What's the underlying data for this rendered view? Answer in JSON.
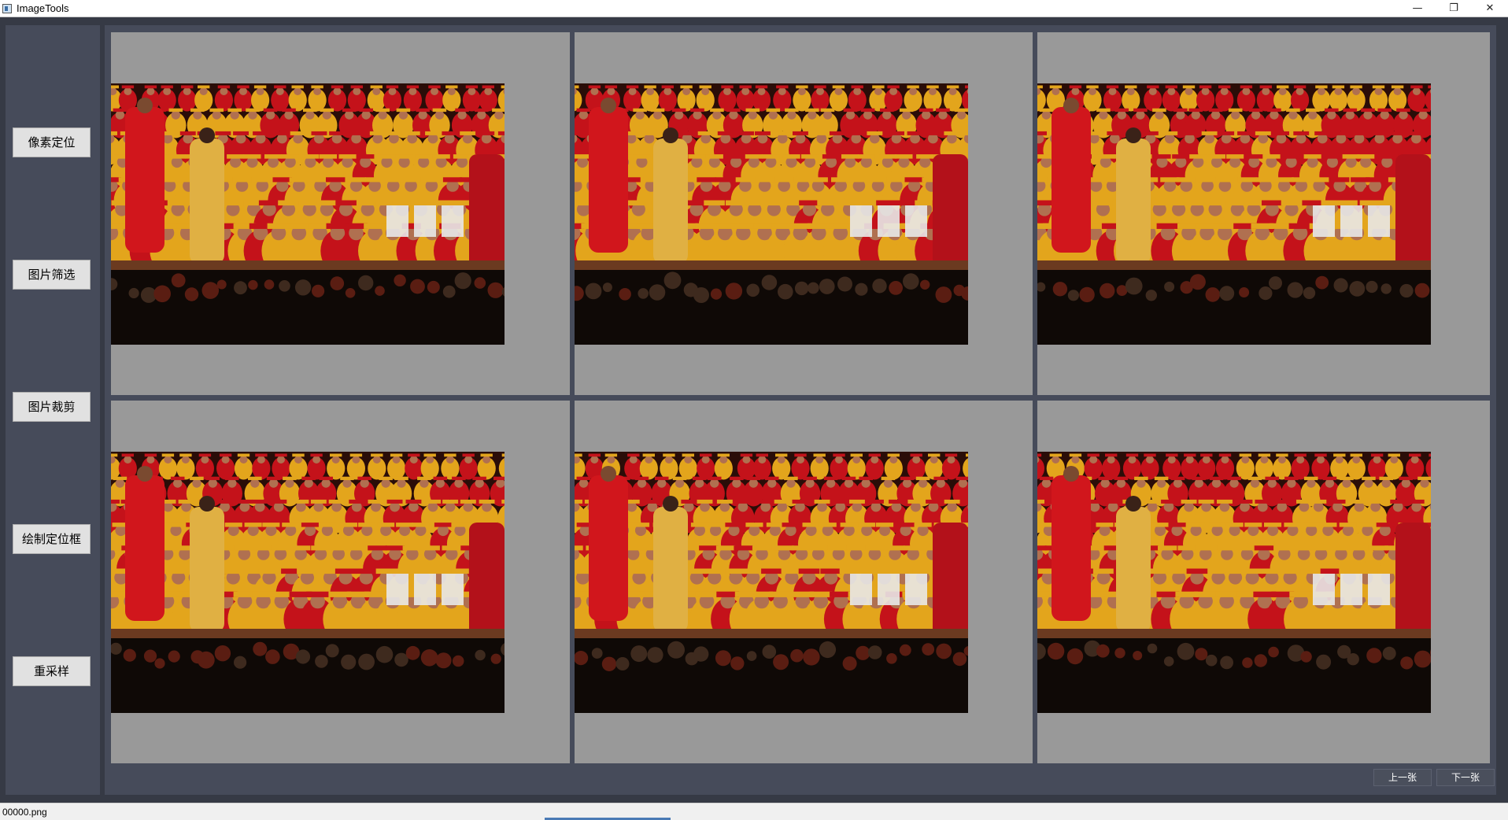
{
  "window": {
    "title": "ImageTools",
    "minimize_glyph": "—",
    "restore_glyph": "❐",
    "close_glyph": "✕"
  },
  "sidebar": {
    "buttons": [
      {
        "label": "像素定位"
      },
      {
        "label": "图片筛选"
      },
      {
        "label": "图片裁剪"
      },
      {
        "label": "绘制定位框"
      },
      {
        "label": "重采样"
      }
    ]
  },
  "gallery": {
    "images": [
      {
        "icon": "graduation-photo"
      },
      {
        "icon": "graduation-photo"
      },
      {
        "icon": "graduation-photo"
      },
      {
        "icon": "graduation-photo"
      },
      {
        "icon": "graduation-photo"
      },
      {
        "icon": "graduation-photo"
      }
    ]
  },
  "navigation": {
    "prev_label": "上一张",
    "next_label": "下一张"
  },
  "status": {
    "filename": "00000.png"
  },
  "colors": {
    "background": "#363a45",
    "panel": "#464b5a",
    "cell": "#999999",
    "gown_gold": "#e3a51c",
    "gown_red": "#c4121a"
  }
}
